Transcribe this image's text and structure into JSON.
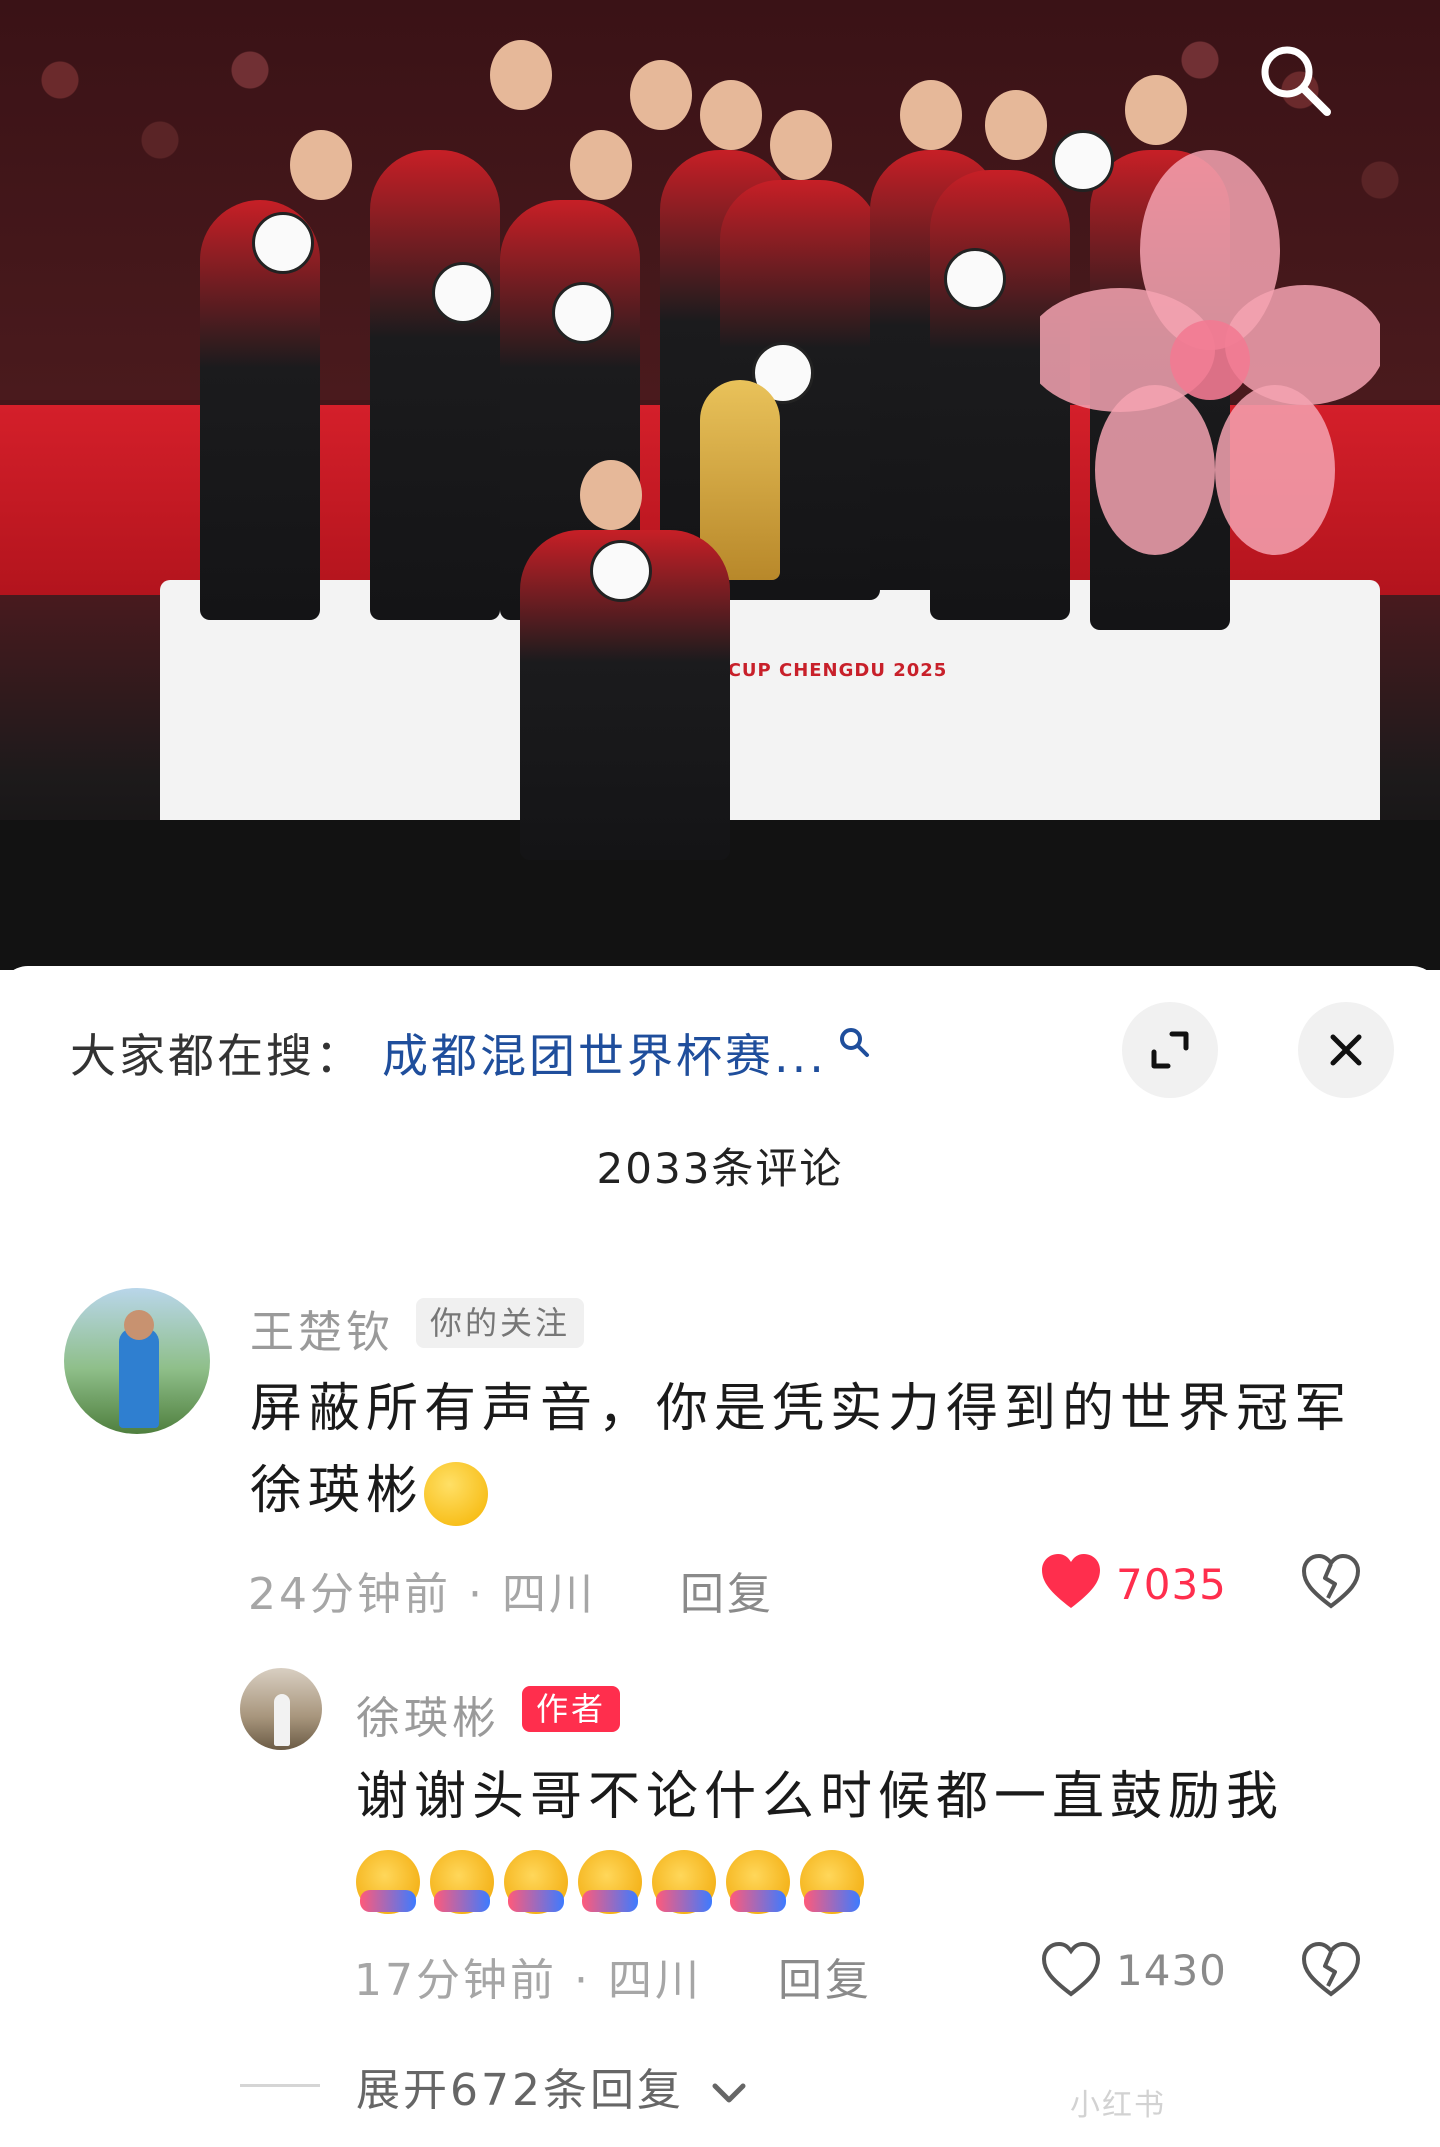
{
  "photo": {
    "podium_text": "WORLD CUP CHENGDU 2025",
    "search_icon": "search-icon"
  },
  "search_bar": {
    "prefix": "大家都在搜：",
    "term": "成都混团世界杯赛...",
    "magnifier_icon": "search-icon",
    "expand_icon": "expand-icon",
    "close_icon": "close-icon"
  },
  "comments_header": {
    "count_text": "2033条评论"
  },
  "comments": [
    {
      "username": "王楚钦",
      "tag": "你的关注",
      "text": "屏蔽所有声音，你是凭实力得到的世界冠军徐瑛彬",
      "emoji": "smirk-emoji",
      "time_location": "24分钟前 · 四川",
      "reply_label": "回复",
      "like_count": "7035",
      "liked": true,
      "like_color": "#ff2e4d"
    }
  ],
  "replies": [
    {
      "username": "徐瑛彬",
      "tag": "作者",
      "text": "谢谢头哥不论什么时候都一直鼓励我",
      "emoji": "hug-emoji",
      "emoji_count": 7,
      "time_location": "17分钟前 · 四川",
      "reply_label": "回复",
      "like_count": "1430",
      "liked": false
    }
  ],
  "expand_replies": {
    "label": "展开672条回复"
  },
  "watermark": "小红书"
}
